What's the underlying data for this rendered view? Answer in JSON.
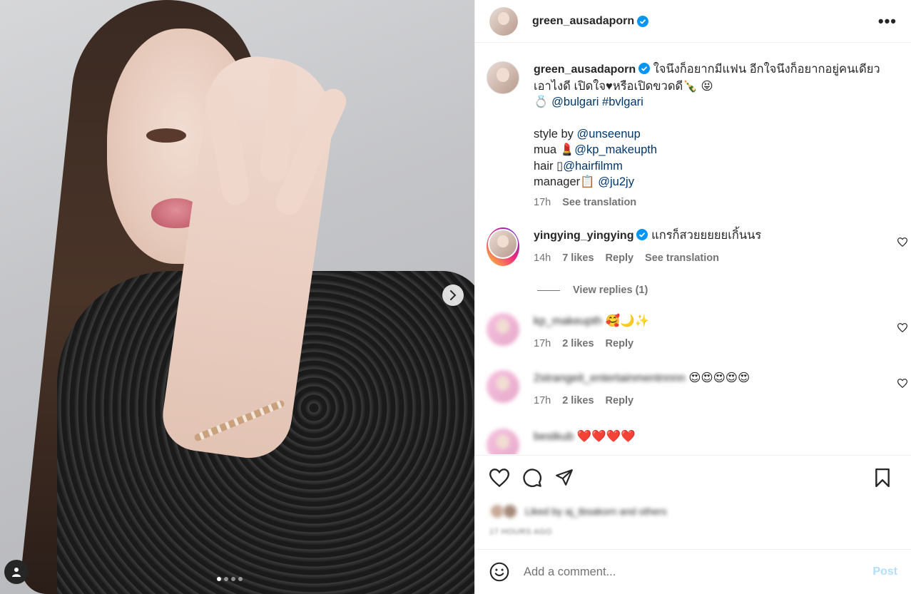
{
  "post": {
    "image_dots": 4,
    "active_dot": 0
  },
  "header": {
    "username": "green_ausadaporn",
    "more_label": "•••"
  },
  "caption": {
    "username": "green_ausadaporn",
    "line1": "ใจนึงก็อยากมีแฟน อีกใจนึงก็อยากอยู่คนเดียว",
    "line2": "เอาไงดี เปิดใจ♥หรือเปิดขวดดี🍾 😝",
    "line3_prefix": "💍 ",
    "mention_bulgari": "@bulgari",
    "hashtag": "#bvlgari",
    "style_label": "style by ",
    "style_mention": "@unseenup",
    "mua_label": "mua 💄",
    "mua_mention": "@kp_makeupth",
    "hair_label": "hair ",
    "hair_icon": "▯",
    "hair_mention": "@hairfilmm",
    "manager_label": "manager📋 ",
    "manager_mention": "@ju2jy",
    "time": "17h",
    "see_translation": "See translation"
  },
  "comments": [
    {
      "username": "yingying_yingying",
      "text": "แกรก็สวยยยยยเกิ้นนร",
      "time": "14h",
      "likes": "7 likes",
      "reply": "Reply",
      "see_translation": "See translation",
      "view_replies": "View replies (1)"
    },
    {
      "username": "kp_makeupth",
      "text": "🥰🌙✨",
      "time": "17h",
      "likes": "2 likes",
      "reply": "Reply"
    },
    {
      "username": "2strangeit_entertainmentnnnn",
      "text": "😍😍😍😍😍",
      "time": "17h",
      "likes": "2 likes",
      "reply": "Reply"
    },
    {
      "username": "bestkub",
      "text": "❤️❤️❤️❤️"
    }
  ],
  "footer": {
    "liked_by": "Liked by aj_tbsakorn and others",
    "posted_ago": "17 HOURS AGO",
    "comment_placeholder": "Add a comment...",
    "post_label": "Post"
  }
}
